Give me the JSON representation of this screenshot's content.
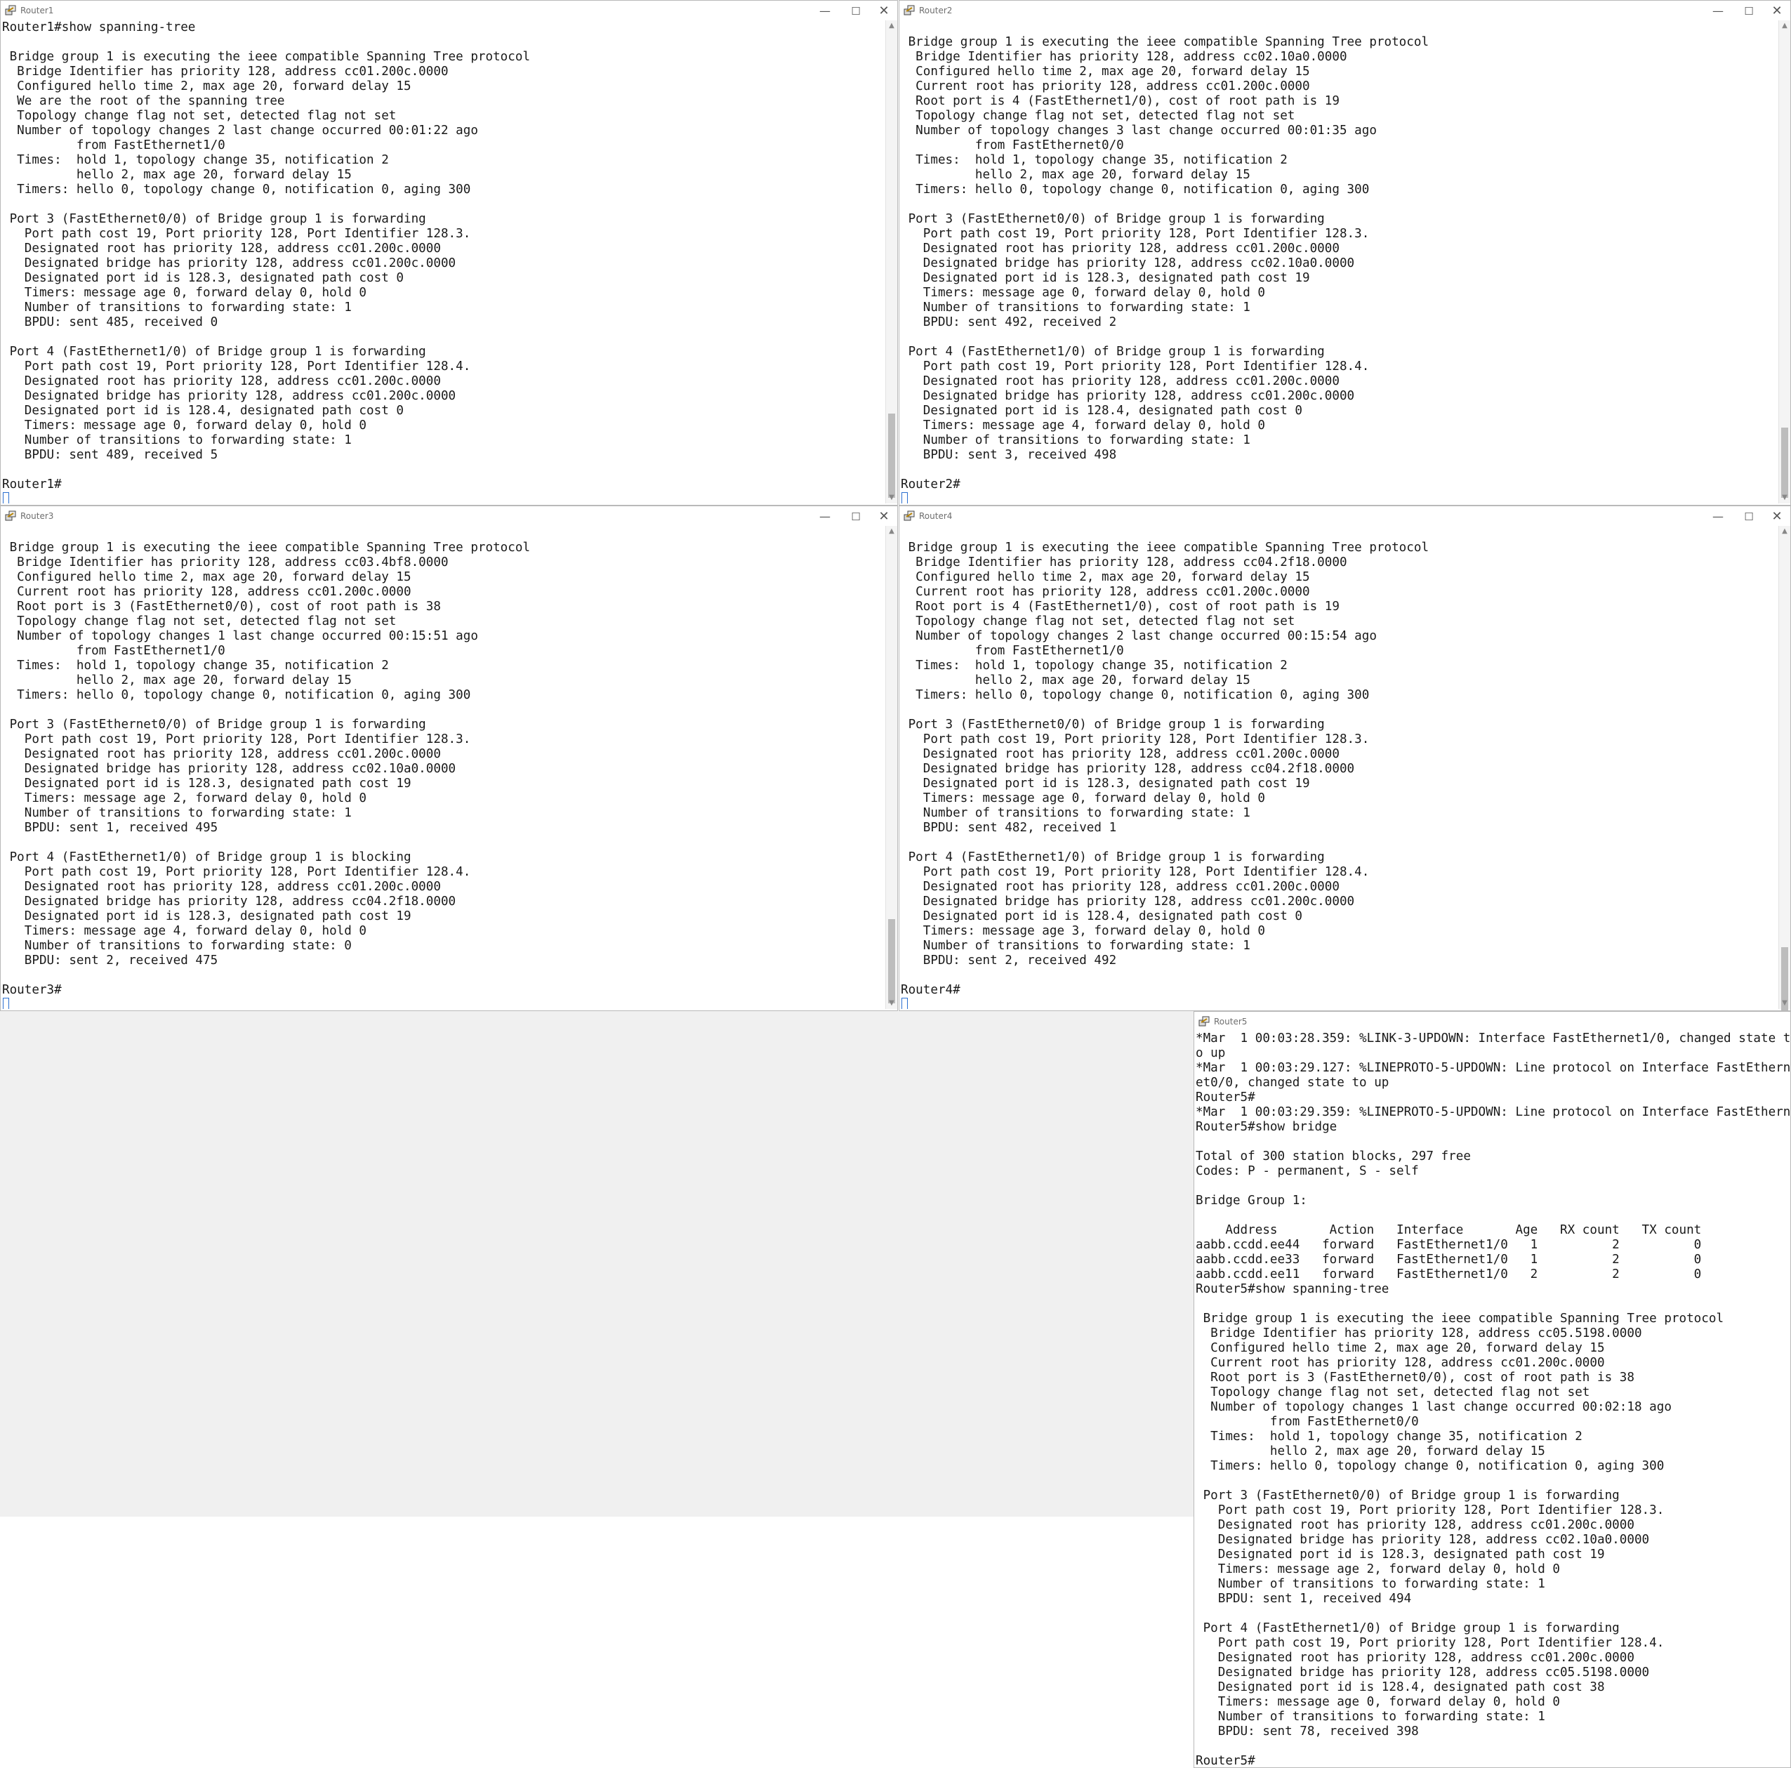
{
  "windows": {
    "router1": {
      "title": "Router1",
      "lines": [
        "Router1#show spanning-tree",
        "",
        " Bridge group 1 is executing the ieee compatible Spanning Tree protocol",
        "  Bridge Identifier has priority 128, address cc01.200c.0000",
        "  Configured hello time 2, max age 20, forward delay 15",
        "  We are the root of the spanning tree",
        "  Topology change flag not set, detected flag not set",
        "  Number of topology changes 2 last change occurred 00:01:22 ago",
        "          from FastEthernet1/0",
        "  Times:  hold 1, topology change 35, notification 2",
        "          hello 2, max age 20, forward delay 15",
        "  Timers: hello 0, topology change 0, notification 0, aging 300",
        "",
        " Port 3 (FastEthernet0/0) of Bridge group 1 is forwarding",
        "   Port path cost 19, Port priority 128, Port Identifier 128.3.",
        "   Designated root has priority 128, address cc01.200c.0000",
        "   Designated bridge has priority 128, address cc01.200c.0000",
        "   Designated port id is 128.3, designated path cost 0",
        "   Timers: message age 0, forward delay 0, hold 0",
        "   Number of transitions to forwarding state: 1",
        "   BPDU: sent 485, received 0",
        "",
        " Port 4 (FastEthernet1/0) of Bridge group 1 is forwarding",
        "   Port path cost 19, Port priority 128, Port Identifier 128.4.",
        "   Designated root has priority 128, address cc01.200c.0000",
        "   Designated bridge has priority 128, address cc01.200c.0000",
        "   Designated port id is 128.4, designated path cost 0",
        "   Timers: message age 0, forward delay 0, hold 0",
        "   Number of transitions to forwarding state: 1",
        "   BPDU: sent 489, received 5",
        ""
      ],
      "prompt": "Router1#"
    },
    "router2": {
      "title": "Router2",
      "lines": [
        "",
        " Bridge group 1 is executing the ieee compatible Spanning Tree protocol",
        "  Bridge Identifier has priority 128, address cc02.10a0.0000",
        "  Configured hello time 2, max age 20, forward delay 15",
        "  Current root has priority 128, address cc01.200c.0000",
        "  Root port is 4 (FastEthernet1/0), cost of root path is 19",
        "  Topology change flag not set, detected flag not set",
        "  Number of topology changes 3 last change occurred 00:01:35 ago",
        "          from FastEthernet0/0",
        "  Times:  hold 1, topology change 35, notification 2",
        "          hello 2, max age 20, forward delay 15",
        "  Timers: hello 0, topology change 0, notification 0, aging 300",
        "",
        " Port 3 (FastEthernet0/0) of Bridge group 1 is forwarding",
        "   Port path cost 19, Port priority 128, Port Identifier 128.3.",
        "   Designated root has priority 128, address cc01.200c.0000",
        "   Designated bridge has priority 128, address cc02.10a0.0000",
        "   Designated port id is 128.3, designated path cost 19",
        "   Timers: message age 0, forward delay 0, hold 0",
        "   Number of transitions to forwarding state: 1",
        "   BPDU: sent 492, received 2",
        "",
        " Port 4 (FastEthernet1/0) of Bridge group 1 is forwarding",
        "   Port path cost 19, Port priority 128, Port Identifier 128.4.",
        "   Designated root has priority 128, address cc01.200c.0000",
        "   Designated bridge has priority 128, address cc01.200c.0000",
        "   Designated port id is 128.4, designated path cost 0",
        "   Timers: message age 4, forward delay 0, hold 0",
        "   Number of transitions to forwarding state: 1",
        "   BPDU: sent 3, received 498",
        ""
      ],
      "prompt": "Router2#"
    },
    "router3": {
      "title": "Router3",
      "lines": [
        "",
        " Bridge group 1 is executing the ieee compatible Spanning Tree protocol",
        "  Bridge Identifier has priority 128, address cc03.4bf8.0000",
        "  Configured hello time 2, max age 20, forward delay 15",
        "  Current root has priority 128, address cc01.200c.0000",
        "  Root port is 3 (FastEthernet0/0), cost of root path is 38",
        "  Topology change flag not set, detected flag not set",
        "  Number of topology changes 1 last change occurred 00:15:51 ago",
        "          from FastEthernet1/0",
        "  Times:  hold 1, topology change 35, notification 2",
        "          hello 2, max age 20, forward delay 15",
        "  Timers: hello 0, topology change 0, notification 0, aging 300",
        "",
        " Port 3 (FastEthernet0/0) of Bridge group 1 is forwarding",
        "   Port path cost 19, Port priority 128, Port Identifier 128.3.",
        "   Designated root has priority 128, address cc01.200c.0000",
        "   Designated bridge has priority 128, address cc02.10a0.0000",
        "   Designated port id is 128.3, designated path cost 19",
        "   Timers: message age 2, forward delay 0, hold 0",
        "   Number of transitions to forwarding state: 1",
        "   BPDU: sent 1, received 495",
        "",
        " Port 4 (FastEthernet1/0) of Bridge group 1 is blocking",
        "   Port path cost 19, Port priority 128, Port Identifier 128.4.",
        "   Designated root has priority 128, address cc01.200c.0000",
        "   Designated bridge has priority 128, address cc04.2f18.0000",
        "   Designated port id is 128.3, designated path cost 19",
        "   Timers: message age 4, forward delay 0, hold 0",
        "   Number of transitions to forwarding state: 0",
        "   BPDU: sent 2, received 475",
        ""
      ],
      "prompt": "Router3#"
    },
    "router4": {
      "title": "Router4",
      "lines": [
        "",
        " Bridge group 1 is executing the ieee compatible Spanning Tree protocol",
        "  Bridge Identifier has priority 128, address cc04.2f18.0000",
        "  Configured hello time 2, max age 20, forward delay 15",
        "  Current root has priority 128, address cc01.200c.0000",
        "  Root port is 4 (FastEthernet1/0), cost of root path is 19",
        "  Topology change flag not set, detected flag not set",
        "  Number of topology changes 2 last change occurred 00:15:54 ago",
        "          from FastEthernet1/0",
        "  Times:  hold 1, topology change 35, notification 2",
        "          hello 2, max age 20, forward delay 15",
        "  Timers: hello 0, topology change 0, notification 0, aging 300",
        "",
        " Port 3 (FastEthernet0/0) of Bridge group 1 is forwarding",
        "   Port path cost 19, Port priority 128, Port Identifier 128.3.",
        "   Designated root has priority 128, address cc01.200c.0000",
        "   Designated bridge has priority 128, address cc04.2f18.0000",
        "   Designated port id is 128.3, designated path cost 19",
        "   Timers: message age 0, forward delay 0, hold 0",
        "   Number of transitions to forwarding state: 1",
        "   BPDU: sent 482, received 1",
        "",
        " Port 4 (FastEthernet1/0) of Bridge group 1 is forwarding",
        "   Port path cost 19, Port priority 128, Port Identifier 128.4.",
        "   Designated root has priority 128, address cc01.200c.0000",
        "   Designated bridge has priority 128, address cc01.200c.0000",
        "   Designated port id is 128.4, designated path cost 0",
        "   Timers: message age 3, forward delay 0, hold 0",
        "   Number of transitions to forwarding state: 1",
        "   BPDU: sent 2, received 492",
        ""
      ],
      "prompt": "Router4#"
    },
    "router5": {
      "title": "Router5",
      "lines": [
        "*Mar  1 00:03:28.359: %LINK-3-UPDOWN: Interface FastEthernet1/0, changed state t",
        "o up",
        "*Mar  1 00:03:29.127: %LINEPROTO-5-UPDOWN: Line protocol on Interface FastEthern",
        "et0/0, changed state to up",
        "Router5#",
        "*Mar  1 00:03:29.359: %LINEPROTO-5-UPDOWN: Line protocol on Interface FastEthern",
        "Router5#show bridge",
        "",
        "Total of 300 station blocks, 297 free",
        "Codes: P - permanent, S - self",
        "",
        "Bridge Group 1:",
        "",
        "    Address       Action   Interface       Age   RX count   TX count",
        "aabb.ccdd.ee44   forward   FastEthernet1/0   1          2          0",
        "aabb.ccdd.ee33   forward   FastEthernet1/0   1          2          0",
        "aabb.ccdd.ee11   forward   FastEthernet1/0   2          2          0",
        "Router5#show spanning-tree",
        "",
        " Bridge group 1 is executing the ieee compatible Spanning Tree protocol",
        "  Bridge Identifier has priority 128, address cc05.5198.0000",
        "  Configured hello time 2, max age 20, forward delay 15",
        "  Current root has priority 128, address cc01.200c.0000",
        "  Root port is 3 (FastEthernet0/0), cost of root path is 38",
        "  Topology change flag not set, detected flag not set",
        "  Number of topology changes 1 last change occurred 00:02:18 ago",
        "          from FastEthernet0/0",
        "  Times:  hold 1, topology change 35, notification 2",
        "          hello 2, max age 20, forward delay 15",
        "  Timers: hello 0, topology change 0, notification 0, aging 300",
        "",
        " Port 3 (FastEthernet0/0) of Bridge group 1 is forwarding",
        "   Port path cost 19, Port priority 128, Port Identifier 128.3.",
        "   Designated root has priority 128, address cc01.200c.0000",
        "   Designated bridge has priority 128, address cc02.10a0.0000",
        "   Designated port id is 128.3, designated path cost 19",
        "   Timers: message age 2, forward delay 0, hold 0",
        "   Number of transitions to forwarding state: 1",
        "   BPDU: sent 1, received 494",
        "",
        " Port 4 (FastEthernet1/0) of Bridge group 1 is forwarding",
        "   Port path cost 19, Port priority 128, Port Identifier 128.4.",
        "   Designated root has priority 128, address cc01.200c.0000",
        "   Designated bridge has priority 128, address cc05.5198.0000",
        "   Designated port id is 128.4, designated path cost 38",
        "   Timers: message age 0, forward delay 0, hold 0",
        "   Number of transitions to forwarding state: 1",
        "   BPDU: sent 78, received 398",
        ""
      ],
      "prompt": "Router5#"
    }
  },
  "controls": {
    "minimize": "—",
    "maximize": "☐",
    "close": "✕",
    "scroll_up": "▲",
    "scroll_down": "▼"
  },
  "colors": {
    "terminal_text": "#1a1a1a",
    "cursor": "#1f63d6",
    "desktop": "#f0f0f0",
    "window_bg": "#ffffff"
  }
}
